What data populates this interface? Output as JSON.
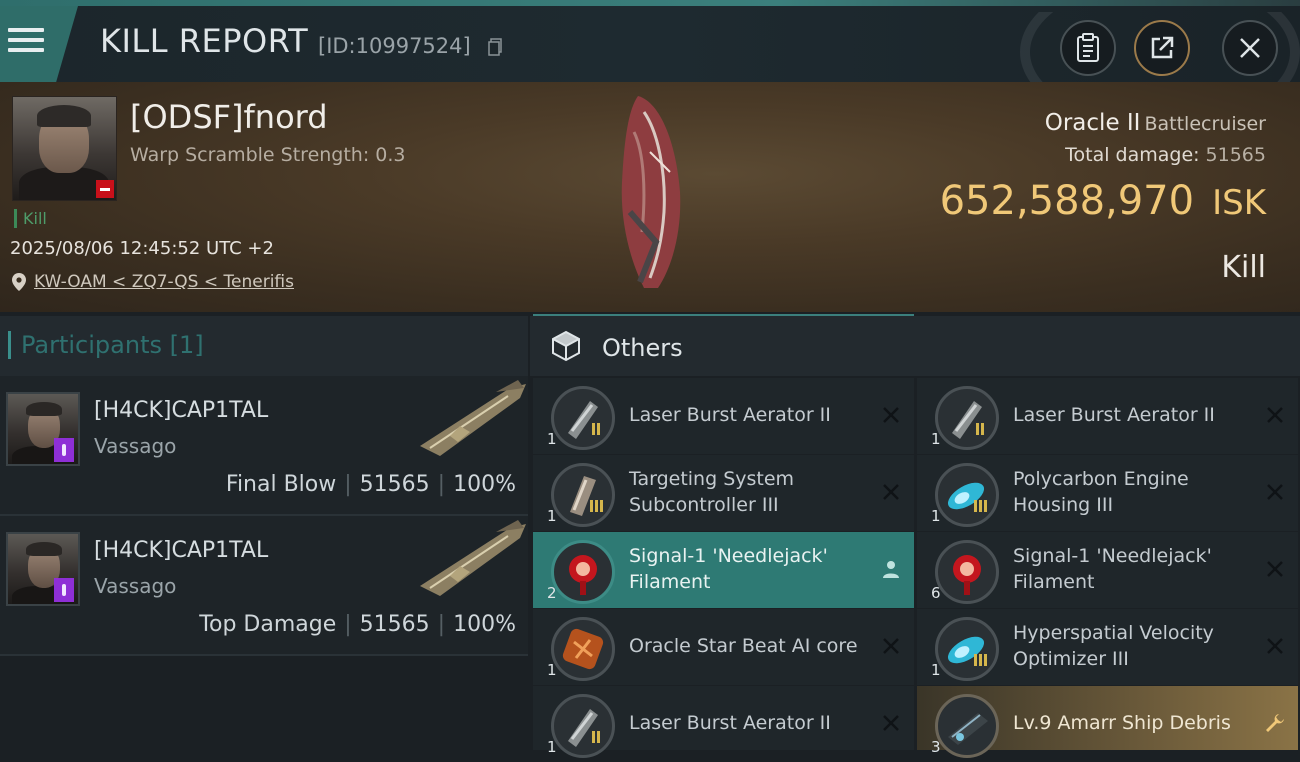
{
  "header": {
    "title": "KILL REPORT",
    "report_id": "[ID:10997524]"
  },
  "victim": {
    "name": "[ODSF]fnord",
    "warp_scramble": "Warp Scramble Strength: 0.3",
    "kill_tag": "Kill",
    "datetime": "2025/08/06 12:45:52 UTC +2",
    "location": "KW-OAM < ZQ7-QS < Tenerifis",
    "ship_name": "Oracle II",
    "ship_class": "Battlecruiser",
    "total_damage_label": "Total damage:",
    "total_damage": "51565",
    "isk_value": "652,588,970",
    "isk_unit": "ISK",
    "result": "Kill"
  },
  "participants": {
    "label": "Participants",
    "count": "[1]",
    "rows": [
      {
        "name": "[H4CK]CAP1TAL",
        "ship": "Vassago",
        "role": "Final Blow",
        "damage": "51565",
        "percent": "100%"
      },
      {
        "name": "[H4CK]CAP1TAL",
        "ship": "Vassago",
        "role": "Top Damage",
        "damage": "51565",
        "percent": "100%"
      }
    ]
  },
  "others": {
    "title": "Others",
    "items": [
      {
        "name": "Laser Burst Aerator II",
        "qty": "1",
        "icon": "laser-aerator-icon",
        "action": "close-icon"
      },
      {
        "name": "Laser Burst Aerator II",
        "qty": "1",
        "icon": "laser-aerator-icon",
        "action": "close-icon"
      },
      {
        "name": "Targeting System Subcontroller III",
        "qty": "1",
        "icon": "targeting-subcontroller-icon",
        "action": "close-icon"
      },
      {
        "name": "Polycarbon Engine Housing III",
        "qty": "1",
        "icon": "engine-housing-icon",
        "action": "close-icon"
      },
      {
        "name": "Signal-1 'Needlejack' Filament",
        "qty": "2",
        "icon": "filament-icon",
        "action": "person-icon"
      },
      {
        "name": "Signal-1 'Needlejack' Filament",
        "qty": "6",
        "icon": "filament-icon",
        "action": "close-icon"
      },
      {
        "name": "Oracle Star Beat AI core",
        "qty": "1",
        "icon": "ai-core-icon",
        "action": "close-icon"
      },
      {
        "name": "Hyperspatial Velocity Optimizer III",
        "qty": "1",
        "icon": "velocity-optimizer-icon",
        "action": "close-icon"
      },
      {
        "name": "Laser Burst Aerator II",
        "qty": "1",
        "icon": "laser-aerator-icon",
        "action": "close-icon"
      },
      {
        "name": "Lv.9 Amarr Ship Debris",
        "qty": "3",
        "icon": "ship-debris-icon",
        "action": "wrench-icon"
      }
    ]
  },
  "colors": {
    "accent_teal": "#3b7f7c",
    "isk_gold": "#f0c878",
    "danger_red": "#c8101a",
    "badge_purple": "#8e2fd6"
  }
}
